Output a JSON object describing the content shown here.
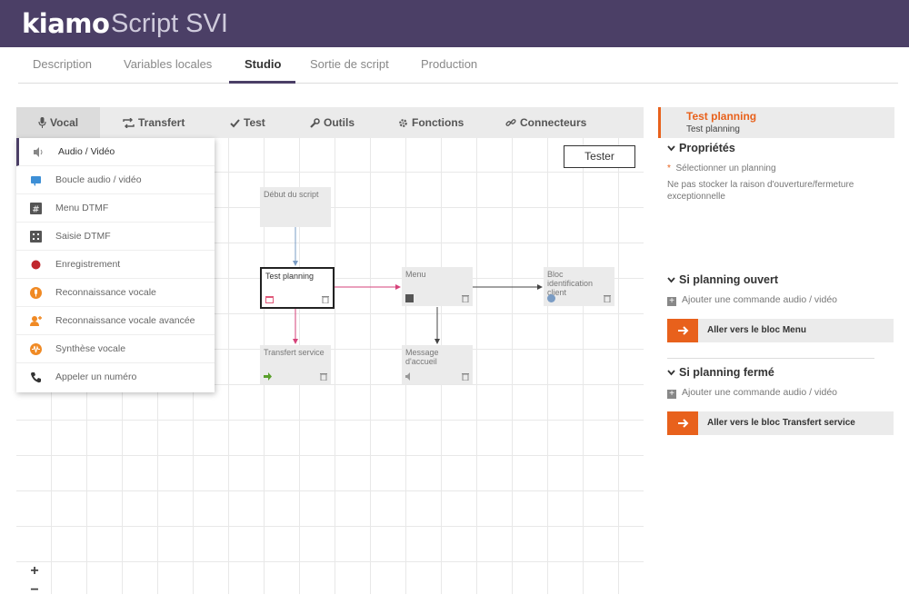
{
  "header": {
    "brand": "kiamo",
    "title": "Script SVI"
  },
  "tabs": [
    {
      "label": "Description",
      "active": false
    },
    {
      "label": "Variables locales",
      "active": false
    },
    {
      "label": "Studio",
      "active": true
    },
    {
      "label": "Sortie de script",
      "active": false
    },
    {
      "label": "Production",
      "active": false
    }
  ],
  "toolbar": {
    "items": [
      {
        "label": "Vocal",
        "icon": "microphone-icon",
        "active": true
      },
      {
        "label": "Transfert",
        "icon": "transfer-icon"
      },
      {
        "label": "Test",
        "icon": "check-icon"
      },
      {
        "label": "Outils",
        "icon": "wrench-icon"
      },
      {
        "label": "Fonctions",
        "icon": "gear-icon"
      },
      {
        "label": "Connecteurs",
        "icon": "link-icon"
      }
    ]
  },
  "vocal_menu": {
    "items": [
      {
        "label": "Audio / Vidéo",
        "icon": "speaker-icon",
        "active": true
      },
      {
        "label": "Boucle audio / vidéo",
        "icon": "loop-icon"
      },
      {
        "label": "Menu DTMF",
        "icon": "hash-icon"
      },
      {
        "label": "Saisie DTMF",
        "icon": "keypad-icon"
      },
      {
        "label": "Enregistrement",
        "icon": "record-icon"
      },
      {
        "label": "Reconnaissance vocale",
        "icon": "voice-recognition-icon"
      },
      {
        "label": "Reconnaissance vocale avancée",
        "icon": "advanced-voice-icon"
      },
      {
        "label": "Synthèse vocale",
        "icon": "waveform-icon"
      },
      {
        "label": "Appeler un numéro",
        "icon": "phone-icon"
      }
    ]
  },
  "canvas": {
    "tester_label": "Tester",
    "start_label": "Début du script",
    "blocks": {
      "test_planning": "Test planning",
      "menu": "Menu",
      "bloc_identification": "Bloc identification client",
      "transfert_service": "Transfert service",
      "message_accueil": "Message d'accueil"
    },
    "zoom_in": "+",
    "zoom_out": "−"
  },
  "properties": {
    "title": "Test planning",
    "subtitle": "Test planning",
    "section_props": "Propriétés",
    "select_planning_star": "*",
    "select_planning": "Sélectionner un planning",
    "no_store": "Ne pas stocker la raison d'ouverture/fermeture exceptionnelle",
    "open_heading": "Si planning ouvert",
    "add_command_1": "Ajouter une commande audio / vidéo",
    "goto_menu": "Aller vers le bloc Menu",
    "closed_heading": "Si planning fermé",
    "add_command_2": "Ajouter une commande audio / vidéo",
    "goto_transfer": "Aller vers le bloc Transfert service"
  },
  "colors": {
    "header": "#4b3f66",
    "accent": "#e8611c"
  }
}
